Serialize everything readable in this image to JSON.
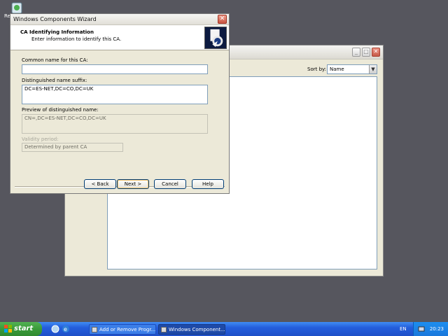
{
  "desktop": {
    "icon_label": "Re"
  },
  "background_window": {
    "sort_label": "Sort by:",
    "sort_value": "Name",
    "minimize_glyph": "_",
    "maximize_glyph": "□",
    "close_glyph": "✕"
  },
  "wizard": {
    "title": "Windows Components Wizard",
    "close_glyph": "✕",
    "header_title": "CA Identifying Information",
    "header_subtitle": "Enter information to identify this CA.",
    "fields": {
      "common_name_label": "Common name for this CA:",
      "common_name_value": "",
      "dn_suffix_label": "Distinguished name suffix:",
      "dn_suffix_value": "DC=ES-NET,DC=CO,DC=UK",
      "preview_label": "Preview of distinguished name:",
      "preview_value": "CN=,DC=ES-NET,DC=CO,DC=UK",
      "validity_label": "Validity period:",
      "validity_value": "Determined by parent CA"
    },
    "buttons": {
      "back": "< Back",
      "next": "Next >",
      "cancel": "Cancel",
      "help": "Help"
    }
  },
  "taskbar": {
    "start_label": "start",
    "tasks": [
      {
        "label": "Add or Remove Progr..."
      },
      {
        "label": "Windows Component..."
      }
    ],
    "language": "EN",
    "clock": "20:23"
  },
  "colors": {
    "desktop": "#56565e",
    "taskbar": "#245edc",
    "start": "#3a9a3a",
    "window_face": "#ece9d8"
  }
}
